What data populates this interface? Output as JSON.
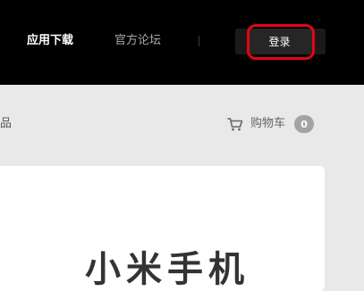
{
  "nav": {
    "app_download": "应用下载",
    "forum": "官方论坛",
    "login": "登录"
  },
  "subbar": {
    "partial_label": "品",
    "cart_label": "购物车",
    "cart_count": "0"
  },
  "hero": {
    "title_partial": "小米手机"
  },
  "icons": {
    "cart": "shopping-cart-icon"
  },
  "colors": {
    "topbar": "#000000",
    "highlight": "#e30613",
    "badge": "#a3a3a3"
  }
}
